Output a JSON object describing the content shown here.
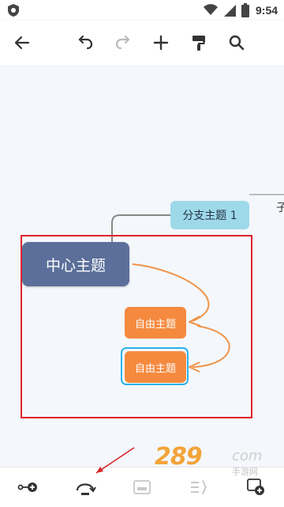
{
  "status_bar": {
    "time": "9:54"
  },
  "toolbar": {
    "buttons": [
      {
        "icon": "back-arrow-icon"
      },
      {
        "icon": "undo-icon"
      },
      {
        "icon": "redo-icon",
        "state": "disabled"
      },
      {
        "icon": "plus-icon"
      },
      {
        "icon": "format-painter-icon"
      },
      {
        "icon": "search-icon"
      }
    ]
  },
  "canvas": {
    "central_topic": "中心主题",
    "branch_topic": "分支主题 1",
    "overflow_text": "子",
    "free_topics": [
      "自由主题",
      "自由主题"
    ]
  },
  "watermark": {
    "digits": "289",
    "suffix": "com",
    "subtitle": "手游网"
  },
  "bottom_bar": {
    "buttons": [
      {
        "icon": "add-child-node-icon"
      },
      {
        "icon": "relationship-line-icon"
      },
      {
        "icon": "summary-box-icon",
        "state": "disabled"
      },
      {
        "icon": "boundary-brace-icon",
        "state": "disabled"
      },
      {
        "icon": "add-floating-topic-icon"
      }
    ]
  },
  "colors": {
    "central": "#5b6f9a",
    "branch": "#9ed9ea",
    "free": "#f58a3f",
    "connector": "#f0944a",
    "selection": "#e0242c",
    "focus_ring": "#2bb3e8"
  }
}
